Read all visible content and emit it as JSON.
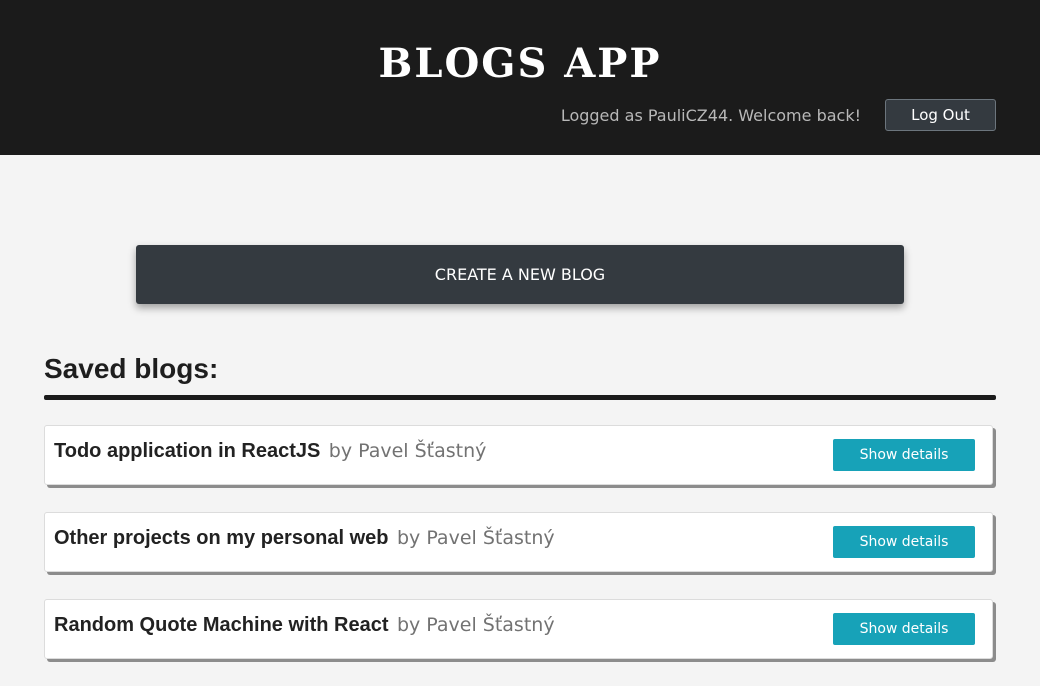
{
  "header": {
    "title": "BLOGS APP",
    "login_status": "Logged as PauliCZ44. Welcome back!",
    "logout_label": "Log Out"
  },
  "main": {
    "create_label": "CREATE A NEW BLOG",
    "section_title": "Saved blogs:",
    "blogs": [
      {
        "title": "Todo application in ReactJS",
        "author": "by Pavel Šťastný",
        "button_label": "Show details"
      },
      {
        "title": "Other projects on my personal web",
        "author": "by Pavel Šťastný",
        "button_label": "Show details"
      },
      {
        "title": "Random Quote Machine with React",
        "author": "by Pavel Šťastný",
        "button_label": "Show details"
      }
    ]
  },
  "colors": {
    "header_bg": "#1b1b1b",
    "page_bg": "#f4f4f4",
    "dark_button": "#343a40",
    "accent": "#17a2b8"
  }
}
